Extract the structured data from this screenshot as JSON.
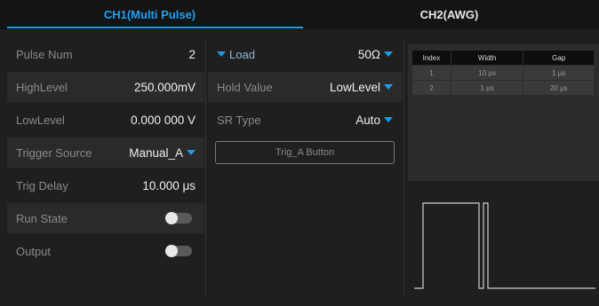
{
  "tabs": [
    {
      "label": "CH1(Multi Pulse)",
      "active": true
    },
    {
      "label": "CH2(AWG)",
      "active": false
    }
  ],
  "left_params": [
    {
      "label": "Pulse Num",
      "value": "2"
    },
    {
      "label": "HighLevel",
      "value": "250.000mV"
    },
    {
      "label": "LowLevel",
      "value": "0.000 000 V"
    },
    {
      "label": "Trigger Source",
      "value": "Manual_A"
    },
    {
      "label": "Trig Delay",
      "value": "10.000 μs"
    },
    {
      "label": "Run State",
      "value": "off"
    },
    {
      "label": "Output",
      "value": "off"
    }
  ],
  "mid_params": [
    {
      "label": "Load",
      "value": "50Ω"
    },
    {
      "label": "Hold Value",
      "value": "LowLevel"
    },
    {
      "label": "SR Type",
      "value": "Auto"
    }
  ],
  "trig_button": "Trig_A Button",
  "pulse_table": {
    "headers": [
      "Index",
      "Width",
      "Gap"
    ],
    "rows": [
      [
        "1",
        "10 μs",
        "1 μs"
      ],
      [
        "2",
        "1 μs",
        "20 μs"
      ]
    ]
  },
  "colors": {
    "accent": "#1f9be8",
    "background": "#1f1f1f"
  }
}
